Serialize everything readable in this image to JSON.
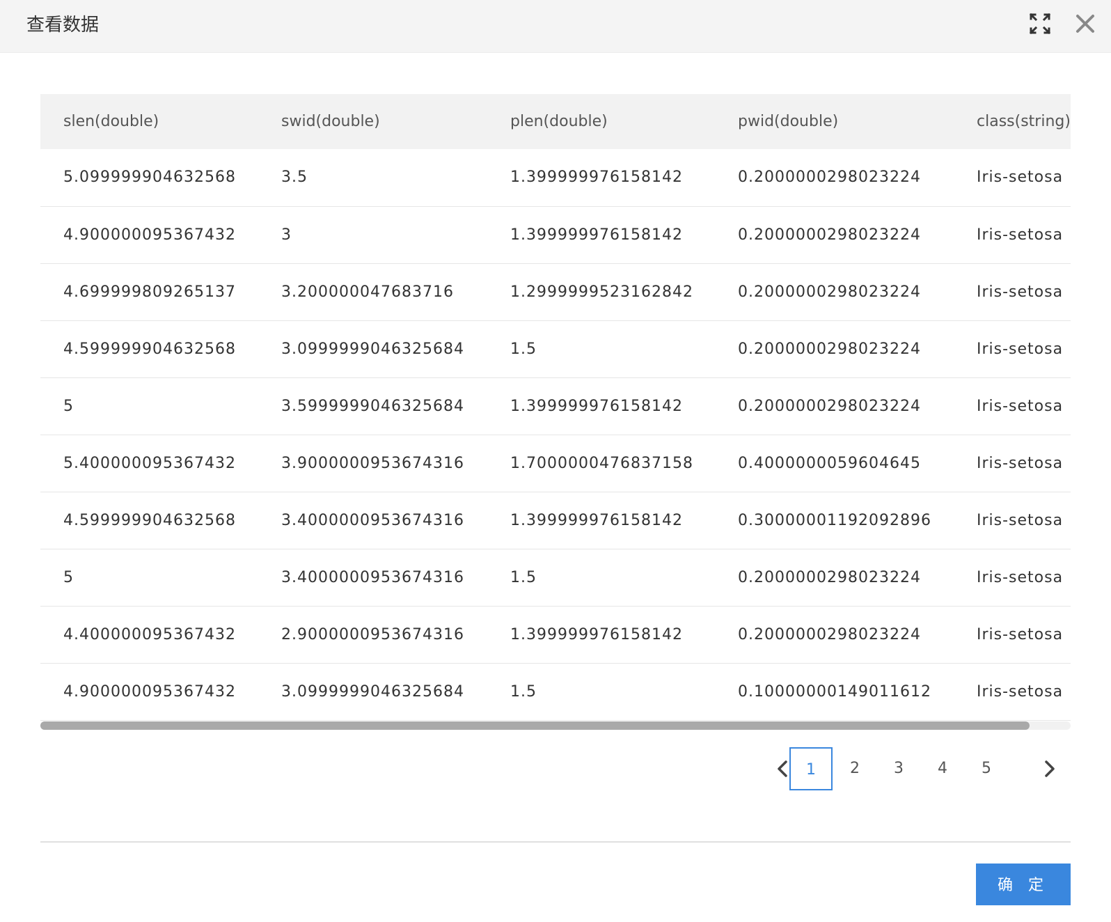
{
  "dialog": {
    "title": "查看数据",
    "confirm_label": "确 定"
  },
  "icons": {
    "expand": "expand-icon",
    "close": "close-icon",
    "prev": "chevron-left-icon",
    "next": "chevron-right-icon"
  },
  "colors": {
    "accent": "#3a87de",
    "header_bg": "#f4f4f4",
    "table_header_bg": "#f2f2f2"
  },
  "table": {
    "columns": [
      "slen(double)",
      "swid(double)",
      "plen(double)",
      "pwid(double)",
      "class(string)"
    ],
    "rows": [
      [
        "5.099999904632568",
        "3.5",
        "1.399999976158142",
        "0.2000000298023224",
        "Iris-setosa"
      ],
      [
        "4.900000095367432",
        "3",
        "1.399999976158142",
        "0.2000000298023224",
        "Iris-setosa"
      ],
      [
        "4.699999809265137",
        "3.200000047683716",
        "1.2999999523162842",
        "0.2000000298023224",
        "Iris-setosa"
      ],
      [
        "4.599999904632568",
        "3.0999999046325684",
        "1.5",
        "0.2000000298023224",
        "Iris-setosa"
      ],
      [
        "5",
        "3.5999999046325684",
        "1.399999976158142",
        "0.2000000298023224",
        "Iris-setosa"
      ],
      [
        "5.400000095367432",
        "3.9000000953674316",
        "1.7000000476837158",
        "0.4000000059604645",
        "Iris-setosa"
      ],
      [
        "4.599999904632568",
        "3.4000000953674316",
        "1.399999976158142",
        "0.30000001192092896",
        "Iris-setosa"
      ],
      [
        "5",
        "3.4000000953674316",
        "1.5",
        "0.2000000298023224",
        "Iris-setosa"
      ],
      [
        "4.400000095367432",
        "2.9000000953674316",
        "1.399999976158142",
        "0.2000000298023224",
        "Iris-setosa"
      ],
      [
        "4.900000095367432",
        "3.0999999046325684",
        "1.5",
        "0.10000000149011612",
        "Iris-setosa"
      ]
    ]
  },
  "scrollbar": {
    "thumb_fraction": 0.96
  },
  "pagination": {
    "pages": [
      "1",
      "2",
      "3",
      "4",
      "5"
    ],
    "current": "1"
  }
}
